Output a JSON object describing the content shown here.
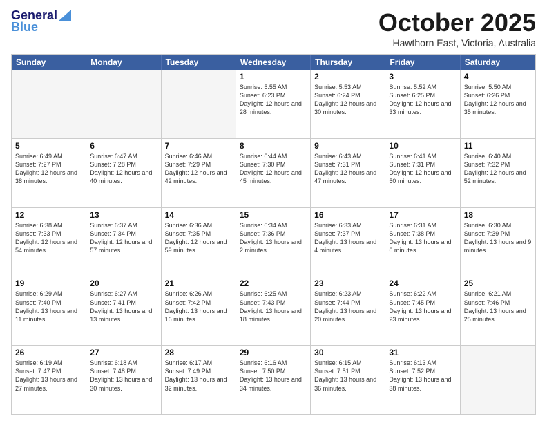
{
  "header": {
    "logo_line1": "General",
    "logo_line2": "Blue",
    "month": "October 2025",
    "location": "Hawthorn East, Victoria, Australia"
  },
  "days": [
    "Sunday",
    "Monday",
    "Tuesday",
    "Wednesday",
    "Thursday",
    "Friday",
    "Saturday"
  ],
  "weeks": [
    [
      {
        "num": "",
        "info": "",
        "empty": true
      },
      {
        "num": "",
        "info": "",
        "empty": true
      },
      {
        "num": "",
        "info": "",
        "empty": true
      },
      {
        "num": "1",
        "info": "Sunrise: 5:55 AM\nSunset: 6:23 PM\nDaylight: 12 hours\nand 28 minutes."
      },
      {
        "num": "2",
        "info": "Sunrise: 5:53 AM\nSunset: 6:24 PM\nDaylight: 12 hours\nand 30 minutes."
      },
      {
        "num": "3",
        "info": "Sunrise: 5:52 AM\nSunset: 6:25 PM\nDaylight: 12 hours\nand 33 minutes."
      },
      {
        "num": "4",
        "info": "Sunrise: 5:50 AM\nSunset: 6:26 PM\nDaylight: 12 hours\nand 35 minutes."
      }
    ],
    [
      {
        "num": "5",
        "info": "Sunrise: 6:49 AM\nSunset: 7:27 PM\nDaylight: 12 hours\nand 38 minutes."
      },
      {
        "num": "6",
        "info": "Sunrise: 6:47 AM\nSunset: 7:28 PM\nDaylight: 12 hours\nand 40 minutes."
      },
      {
        "num": "7",
        "info": "Sunrise: 6:46 AM\nSunset: 7:29 PM\nDaylight: 12 hours\nand 42 minutes."
      },
      {
        "num": "8",
        "info": "Sunrise: 6:44 AM\nSunset: 7:30 PM\nDaylight: 12 hours\nand 45 minutes."
      },
      {
        "num": "9",
        "info": "Sunrise: 6:43 AM\nSunset: 7:31 PM\nDaylight: 12 hours\nand 47 minutes."
      },
      {
        "num": "10",
        "info": "Sunrise: 6:41 AM\nSunset: 7:31 PM\nDaylight: 12 hours\nand 50 minutes."
      },
      {
        "num": "11",
        "info": "Sunrise: 6:40 AM\nSunset: 7:32 PM\nDaylight: 12 hours\nand 52 minutes."
      }
    ],
    [
      {
        "num": "12",
        "info": "Sunrise: 6:38 AM\nSunset: 7:33 PM\nDaylight: 12 hours\nand 54 minutes."
      },
      {
        "num": "13",
        "info": "Sunrise: 6:37 AM\nSunset: 7:34 PM\nDaylight: 12 hours\nand 57 minutes."
      },
      {
        "num": "14",
        "info": "Sunrise: 6:36 AM\nSunset: 7:35 PM\nDaylight: 12 hours\nand 59 minutes."
      },
      {
        "num": "15",
        "info": "Sunrise: 6:34 AM\nSunset: 7:36 PM\nDaylight: 13 hours\nand 2 minutes."
      },
      {
        "num": "16",
        "info": "Sunrise: 6:33 AM\nSunset: 7:37 PM\nDaylight: 13 hours\nand 4 minutes."
      },
      {
        "num": "17",
        "info": "Sunrise: 6:31 AM\nSunset: 7:38 PM\nDaylight: 13 hours\nand 6 minutes."
      },
      {
        "num": "18",
        "info": "Sunrise: 6:30 AM\nSunset: 7:39 PM\nDaylight: 13 hours\nand 9 minutes."
      }
    ],
    [
      {
        "num": "19",
        "info": "Sunrise: 6:29 AM\nSunset: 7:40 PM\nDaylight: 13 hours\nand 11 minutes."
      },
      {
        "num": "20",
        "info": "Sunrise: 6:27 AM\nSunset: 7:41 PM\nDaylight: 13 hours\nand 13 minutes."
      },
      {
        "num": "21",
        "info": "Sunrise: 6:26 AM\nSunset: 7:42 PM\nDaylight: 13 hours\nand 16 minutes."
      },
      {
        "num": "22",
        "info": "Sunrise: 6:25 AM\nSunset: 7:43 PM\nDaylight: 13 hours\nand 18 minutes."
      },
      {
        "num": "23",
        "info": "Sunrise: 6:23 AM\nSunset: 7:44 PM\nDaylight: 13 hours\nand 20 minutes."
      },
      {
        "num": "24",
        "info": "Sunrise: 6:22 AM\nSunset: 7:45 PM\nDaylight: 13 hours\nand 23 minutes."
      },
      {
        "num": "25",
        "info": "Sunrise: 6:21 AM\nSunset: 7:46 PM\nDaylight: 13 hours\nand 25 minutes."
      }
    ],
    [
      {
        "num": "26",
        "info": "Sunrise: 6:19 AM\nSunset: 7:47 PM\nDaylight: 13 hours\nand 27 minutes."
      },
      {
        "num": "27",
        "info": "Sunrise: 6:18 AM\nSunset: 7:48 PM\nDaylight: 13 hours\nand 30 minutes."
      },
      {
        "num": "28",
        "info": "Sunrise: 6:17 AM\nSunset: 7:49 PM\nDaylight: 13 hours\nand 32 minutes."
      },
      {
        "num": "29",
        "info": "Sunrise: 6:16 AM\nSunset: 7:50 PM\nDaylight: 13 hours\nand 34 minutes."
      },
      {
        "num": "30",
        "info": "Sunrise: 6:15 AM\nSunset: 7:51 PM\nDaylight: 13 hours\nand 36 minutes."
      },
      {
        "num": "31",
        "info": "Sunrise: 6:13 AM\nSunset: 7:52 PM\nDaylight: 13 hours\nand 38 minutes."
      },
      {
        "num": "",
        "info": "",
        "empty": true
      }
    ]
  ]
}
